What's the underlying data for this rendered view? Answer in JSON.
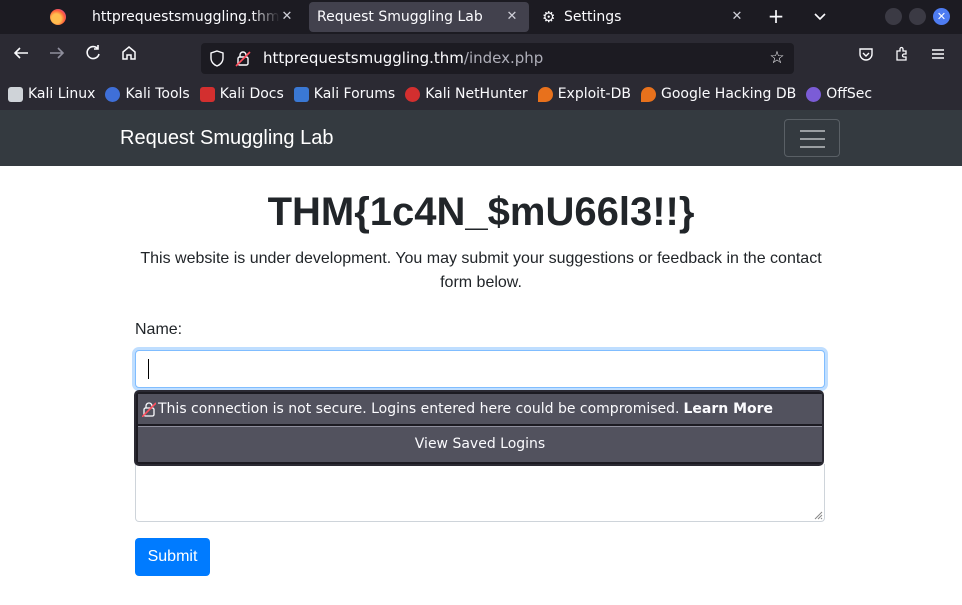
{
  "browser": {
    "tabs": [
      {
        "label": "httprequestsmuggling.thm/s",
        "close": "✕"
      },
      {
        "label": "Request Smuggling Lab",
        "close": "✕"
      },
      {
        "label": "Settings",
        "close": "✕"
      }
    ],
    "new_tab": "+",
    "tab_list": "⌄",
    "url": {
      "host": "httprequestsmuggling.thm",
      "path": "/index.php"
    },
    "bookmarks": [
      {
        "label": "Kali Linux",
        "icon": "kali-dragon-icon",
        "color": "#cfd3d8"
      },
      {
        "label": "Kali Tools",
        "icon": "kali-tools-icon",
        "color": "#3f6fd8"
      },
      {
        "label": "Kali Docs",
        "icon": "kali-docs-icon",
        "color": "#d32f2f"
      },
      {
        "label": "Kali Forums",
        "icon": "kali-forums-icon",
        "color": "#3a78d4"
      },
      {
        "label": "Kali NetHunter",
        "icon": "nethunter-icon",
        "color": "#d32f2f"
      },
      {
        "label": "Exploit-DB",
        "icon": "exploit-db-icon",
        "color": "#e8711c"
      },
      {
        "label": "Google Hacking DB",
        "icon": "ghdb-icon",
        "color": "#e8711c"
      },
      {
        "label": "OffSec",
        "icon": "offsec-icon",
        "color": "#7b5cd6"
      }
    ]
  },
  "site": {
    "brand": "Request Smuggling Lab",
    "title": "THM{1c4N_$mU66l3!!}",
    "lead": "This website is under development. You may submit your suggestions or feedback in the contact form below.",
    "form": {
      "name_label": "Name:",
      "name_value": "",
      "submit_label": "Submit"
    }
  },
  "autofill_popup": {
    "warning": "This connection is not secure. Logins entered here could be compromised.",
    "learn_more": "Learn More",
    "view_saved": "View Saved Logins"
  },
  "colors": {
    "tab_bg": "#1c1b22",
    "toolbar_bg": "#2b2a33",
    "site_nav_bg": "#343a40",
    "primary": "#007bff",
    "focus_border": "#80bdff"
  }
}
